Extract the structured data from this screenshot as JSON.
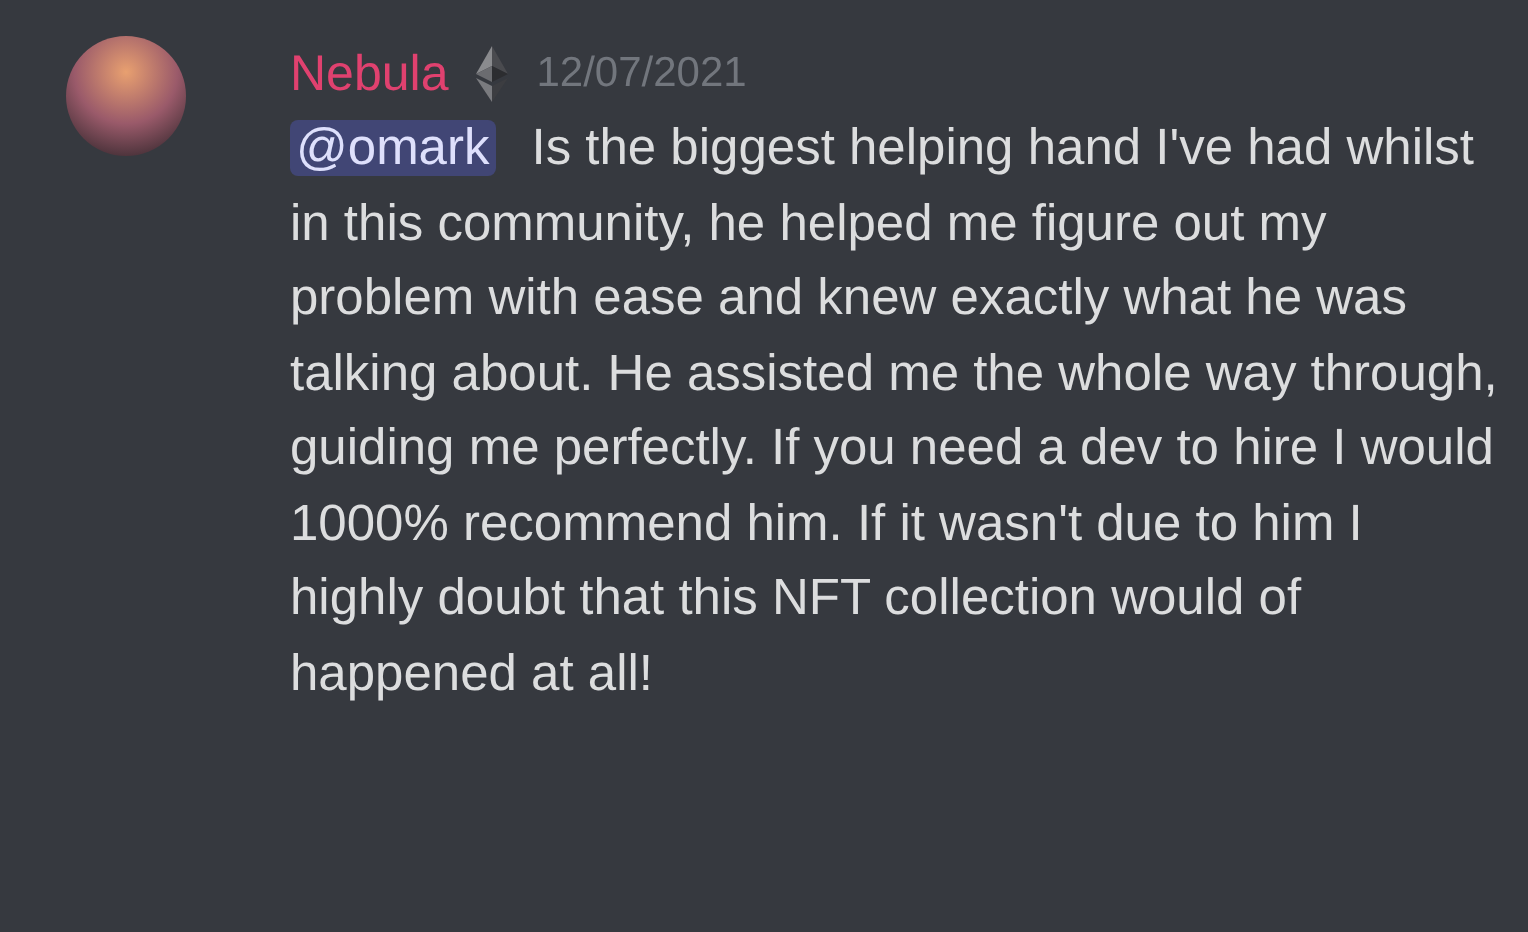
{
  "message": {
    "author": "Nebula",
    "timestamp": "12/07/2021",
    "mention": "@omark",
    "text": "Is the biggest helping hand I've had whilst in this community, he helped me figure out my problem with ease and knew exactly what he was talking about. He assisted me the whole way through, guiding me perfectly. If you need a dev to hire I would 1000% recommend him. If it wasn't due to him I highly doubt that this NFT collection would of happened at all!"
  }
}
